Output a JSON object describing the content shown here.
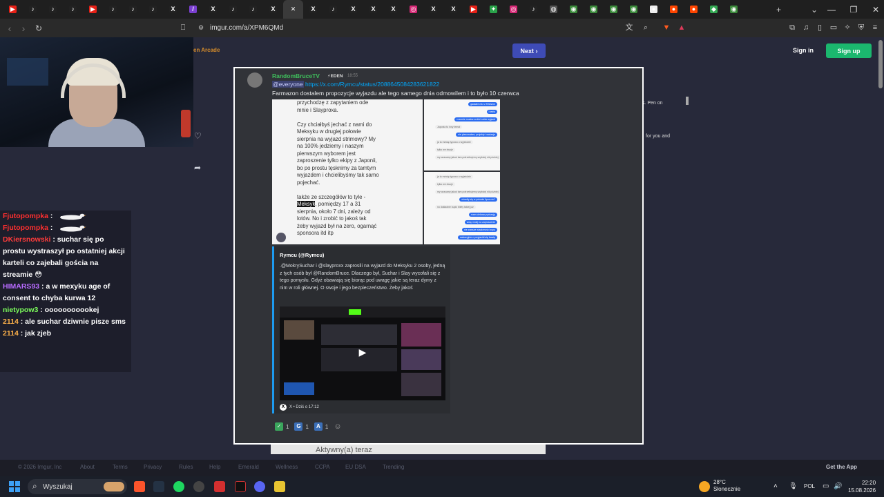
{
  "browser": {
    "tabs": [
      {
        "icon": "youtube-icon",
        "color": "#e62117",
        "glyph": "▶"
      },
      {
        "icon": "tiktok-icon",
        "color": "#222",
        "glyph": "♪"
      },
      {
        "icon": "tiktok-icon",
        "color": "#222",
        "glyph": "♪"
      },
      {
        "icon": "tiktok-icon",
        "color": "#222",
        "glyph": "♪"
      },
      {
        "icon": "youtube-icon",
        "color": "#e62117",
        "glyph": "▶"
      },
      {
        "icon": "tiktok-icon",
        "color": "#222",
        "glyph": "♪"
      },
      {
        "icon": "tiktok-icon",
        "color": "#222",
        "glyph": "♪"
      },
      {
        "icon": "tiktok-icon",
        "color": "#222",
        "glyph": "♪"
      },
      {
        "icon": "x-icon",
        "color": "#222",
        "glyph": "X"
      },
      {
        "icon": "feather-icon",
        "color": "#7a3fd0",
        "glyph": "/"
      },
      {
        "icon": "x-icon",
        "color": "#222",
        "glyph": "X"
      },
      {
        "icon": "tiktok-icon",
        "color": "#222",
        "glyph": "♪"
      },
      {
        "icon": "tiktok-icon",
        "color": "#222",
        "glyph": "♪"
      },
      {
        "icon": "x-icon",
        "color": "#222",
        "glyph": "X"
      },
      {
        "icon": "close-icon",
        "color": "#3a3a3a",
        "glyph": "✕",
        "active": true
      },
      {
        "icon": "x-icon",
        "color": "#222",
        "glyph": "X"
      },
      {
        "icon": "tiktok-icon",
        "color": "#222",
        "glyph": "♪"
      },
      {
        "icon": "x-icon",
        "color": "#222",
        "glyph": "X"
      },
      {
        "icon": "x-icon",
        "color": "#222",
        "glyph": "X"
      },
      {
        "icon": "x-icon",
        "color": "#222",
        "glyph": "X"
      },
      {
        "icon": "instagram-icon",
        "color": "#d62976",
        "glyph": "◎"
      },
      {
        "icon": "x-icon",
        "color": "#222",
        "glyph": "X"
      },
      {
        "icon": "x-icon",
        "color": "#222",
        "glyph": "X"
      },
      {
        "icon": "youtube-icon",
        "color": "#e62117",
        "glyph": "▶"
      },
      {
        "icon": "pinwheel-icon",
        "color": "#2aa34a",
        "glyph": "✦"
      },
      {
        "icon": "instagram-icon",
        "color": "#d62976",
        "glyph": "◎"
      },
      {
        "icon": "tiktok-icon",
        "color": "#222",
        "glyph": "♪"
      },
      {
        "icon": "globe-icon",
        "color": "#555",
        "glyph": "◍"
      },
      {
        "icon": "chrome-icon",
        "color": "#3b8a3b",
        "glyph": "◉"
      },
      {
        "icon": "chrome-icon",
        "color": "#3b8a3b",
        "glyph": "◉"
      },
      {
        "icon": "chrome-icon",
        "color": "#3b8a3b",
        "glyph": "◉"
      },
      {
        "icon": "chrome-icon",
        "color": "#3b8a3b",
        "glyph": "◉"
      },
      {
        "icon": "circle-icon",
        "color": "#eee",
        "glyph": "●"
      },
      {
        "icon": "reddit-icon",
        "color": "#ff4500",
        "glyph": "●"
      },
      {
        "icon": "reddit-icon",
        "color": "#ff4500",
        "glyph": "●"
      },
      {
        "icon": "maps-icon",
        "color": "#34a853",
        "glyph": "◆"
      },
      {
        "icon": "chrome-icon",
        "color": "#3b8a3b",
        "glyph": "◉"
      }
    ],
    "new_tab": "+",
    "url": "imgur.com/a/XPM6QMd"
  },
  "imgur": {
    "arcade_label": "en Arcade",
    "next_label": "Next",
    "signin_label": "Sign in",
    "signup_label": "Sign up",
    "right_fragment_1": "s. Pen on",
    "right_fragment_2": "for you and"
  },
  "chat": [
    {
      "user": "Fjutopompka",
      "color": "#ff2f2f",
      "sep": " : ",
      "text": "",
      "duck": true
    },
    {
      "user": "Fjutopompka",
      "color": "#ff2f2f",
      "sep": " : ",
      "text": "",
      "duck": true
    },
    {
      "user": "DKiersnowski",
      "color": "#ff3b3b",
      "sep": " : ",
      "text": "suchar się po prostu wystraszył po ostatniej akcji karteli co zajebali gościa na streamie 😳"
    },
    {
      "user": "HIMARS93",
      "color": "#b86bff",
      "sep": " : ",
      "text": "a w mexyku age of consent to chyba kurwa 12"
    },
    {
      "user": "nietypow3",
      "color": "#7dff5c",
      "sep": " : ",
      "text": "ooooooooookej"
    },
    {
      "user": "2114",
      "color": "#ffb24a",
      "sep": " : ",
      "text": "ale suchar dziwnie pisze sms"
    },
    {
      "user": "2114",
      "color": "#ffb24a",
      "sep": " : ",
      "text": "jak zjeb"
    }
  ],
  "discord": {
    "author": "RandomBruceTV",
    "tag": "⚡EDEN",
    "time": "18:55",
    "mention": "@everyone",
    "link": "https://x.com/Rymcu/status/2088645084283621822",
    "message": "Farmazon dostalem propozycje wyjazdu ale tego samego dnia odmowilem i to było 10 czerwca",
    "sms_before": "przychodzę z zapytaniem ode\nmnie i Slayproxa.\n\nCzy chciałbyś jechać z nami do\nMeksyku w drugiej połowie\nsierpnia na wyjazd strimowy? My\nna 100% jedziemy i naszym\npierwszym wyborem jest\nzaproszenie tylko ekipy z Japonii,\nbo po prostu tęsknimy za tamtym\nwyjazdem i chcielibyśmy tak samo\npojechać.\n\ntakże ze szczegółów to tyle -\n",
    "sms_highlight": "Meksyk",
    "sms_after": ", pomiędzy 17 a 31\nsierpnia, około 7 dni, zależy od\nlotów. No i zrobić to jakoś tak\nżeby wyjazd był na zero, ogarnąć\nsponsora itd itp",
    "bubbles2": [
      {
        "t": "gadałem też z Tetrisem",
        "b": true
      },
      {
        "t": "i tetris",
        "b": true
      },
      {
        "t": "rozumie musisz zrobić sobie wyjazd",
        "b": true
      },
      {
        "t": "Japonia to inny temat",
        "b": false
      },
      {
        "t": "nie planowałem, projekty i wakacje",
        "b": true
      },
      {
        "t": "ja tu mówię typowo o wyjeździe",
        "b": false
      },
      {
        "t": "tylko we dwoje",
        "b": false
      },
      {
        "t": "my wracamy jakoś tam potrzebujemy szybciej niż później",
        "b": false
      }
    ],
    "bubbles3": [
      {
        "t": "ja tu mówię typowo o wyjeździe",
        "b": false
      },
      {
        "t": "tylko we dwoje",
        "b": false
      },
      {
        "t": "my wracamy jakoś tam potrzebujemy szybciej niż później",
        "b": false
      },
      {
        "t": "okradły się w połowie lipca nie?",
        "b": true
      },
      {
        "t": "no dokładnie kupić bilety takiej już",
        "b": false
      },
      {
        "t": "mam ciekawą sytuację",
        "b": true
      },
      {
        "t": "wolę mniej na zaproszenie",
        "b": true
      },
      {
        "t": "nie zawsze wiadomości zupy",
        "b": true
      },
      {
        "t": "wakacyjnie z przyjaciół się bawię",
        "b": true
      }
    ],
    "embed_author": "Rymcu (@Rymcu)",
    "embed_text": ".@MokrySuchar i @slayproxx zaprosili na wyjazd do Meksyku 2 osoby, jedną z tych osób był @RandomBruce. Dlaczego był, Suchar i Slay wycofali się z tego pomysłu. Gdyż obawiają się biorąc pod uwagę jakie są teraz dymy z nim w roli głównej. O swoje i jego bezpieczeństwo. Żeby jakoś",
    "embed_footer": "X • Dziś o 17:12",
    "reactions": [
      {
        "emoji": "✓",
        "bg": "#3aa55c",
        "count": "1"
      },
      {
        "emoji": "G",
        "bg": "#3b6fb8",
        "count": "1"
      },
      {
        "emoji": "A",
        "bg": "#3b6fb8",
        "count": "1"
      }
    ],
    "below_text": "Aktywny(a) teraz"
  },
  "footer": {
    "links": [
      "© 2026 Imgur, Inc",
      "About",
      "Terms",
      "Privacy",
      "Rules",
      "Help",
      "Emerald",
      "Wellness",
      "CCPA",
      "EU DSA",
      "Trending"
    ],
    "get_app": "Get the App"
  },
  "taskbar": {
    "search_placeholder": "Wyszukaj",
    "weather_temp": "28°C",
    "weather_desc": "Słonecznie",
    "language": "POL",
    "time": "22:20",
    "date": "15.08.2026"
  }
}
